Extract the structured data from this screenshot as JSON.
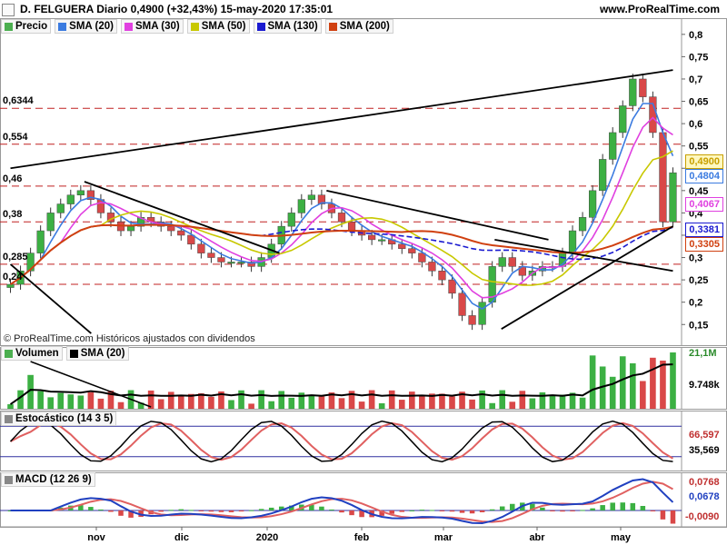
{
  "header": {
    "title": "D. FELGUERA Diario 0,4900 (+32,43%) 15-may-2020 17:35:01",
    "brand": "www.ProRealTime.com"
  },
  "price_legend": [
    {
      "label": "Precio",
      "color": "#4caf50"
    },
    {
      "label": "SMA (20)",
      "color": "#3b7be0"
    },
    {
      "label": "SMA (30)",
      "color": "#e040e0"
    },
    {
      "label": "SMA (50)",
      "color": "#c8c800"
    },
    {
      "label": "SMA (130)",
      "color": "#1a1ad0"
    },
    {
      "label": "SMA (200)",
      "color": "#d04010"
    }
  ],
  "copyright": "© ProRealTime.com Históricos ajustados con dividendos",
  "level_labels": [
    "0,6344",
    "0,554",
    "0,46",
    "0,38",
    "0,285",
    "0,24"
  ],
  "price_axis": [
    "0,8",
    "0,75",
    "0,7",
    "0,65",
    "0,6",
    "0,55",
    "0,5",
    "0,45",
    "0,4",
    "0,35",
    "0,3",
    "0,25",
    "0,2",
    "0,15"
  ],
  "price_boxes": [
    {
      "text": "0,4900",
      "color": "#c8a000",
      "bg": "#fff8c0"
    },
    {
      "text": "0,4804",
      "color": "#3b7be0",
      "bg": "#ffffff"
    },
    {
      "text": "0,4067",
      "color": "#e040e0",
      "bg": "#ffffff"
    },
    {
      "text": "0,3381",
      "color": "#1a1ad0",
      "bg": "#ffffff"
    },
    {
      "text": "0,3305",
      "color": "#d04010",
      "bg": "#ffffff"
    }
  ],
  "volume": {
    "legend": [
      {
        "label": "Volumen",
        "color": "#4caf50"
      },
      {
        "label": "SMA (20)",
        "color": "#000000"
      }
    ],
    "axis_labels": [
      "21,1M",
      "9.748k"
    ]
  },
  "stochastic": {
    "label": "Estocástico (14 3 5)",
    "axis_labels": [
      "66,597",
      "35,569"
    ]
  },
  "macd": {
    "label": "MACD (12 26 9)",
    "axis_labels": [
      "0,0768",
      "0,0678",
      "-0,0090"
    ]
  },
  "x_labels": [
    "nov",
    "dic",
    "2020",
    "feb",
    "mar",
    "abr",
    "may"
  ],
  "chart_data": {
    "type": "candlestick",
    "title": "D. FELGUERA Diario 0,4900 (+32,43%) 15-may-2020 17:35:01",
    "price_axis_range": [
      0.12,
      0.82
    ],
    "series": [
      {
        "name": "Precio",
        "approx_close": [
          0.24,
          0.27,
          0.31,
          0.36,
          0.4,
          0.42,
          0.44,
          0.45,
          0.43,
          0.4,
          0.38,
          0.36,
          0.37,
          0.39,
          0.38,
          0.37,
          0.36,
          0.35,
          0.33,
          0.31,
          0.3,
          0.29,
          0.29,
          0.29,
          0.28,
          0.3,
          0.33,
          0.37,
          0.4,
          0.43,
          0.44,
          0.42,
          0.4,
          0.38,
          0.36,
          0.35,
          0.34,
          0.34,
          0.33,
          0.32,
          0.31,
          0.29,
          0.27,
          0.25,
          0.22,
          0.17,
          0.15,
          0.2,
          0.28,
          0.3,
          0.28,
          0.26,
          0.27,
          0.28,
          0.28,
          0.31,
          0.36,
          0.39,
          0.45,
          0.52,
          0.58,
          0.64,
          0.7,
          0.66,
          0.58,
          0.38,
          0.49
        ]
      },
      {
        "name": "SMA (20)",
        "color": "#3b7be0"
      },
      {
        "name": "SMA (30)",
        "color": "#e040e0"
      },
      {
        "name": "SMA (50)",
        "color": "#c8c800"
      },
      {
        "name": "SMA (130)",
        "color": "#1a1ad0"
      },
      {
        "name": "SMA (200)",
        "color": "#d04010"
      }
    ],
    "horizontal_levels": [
      0.6344,
      0.554,
      0.46,
      0.38,
      0.285,
      0.24
    ]
  }
}
